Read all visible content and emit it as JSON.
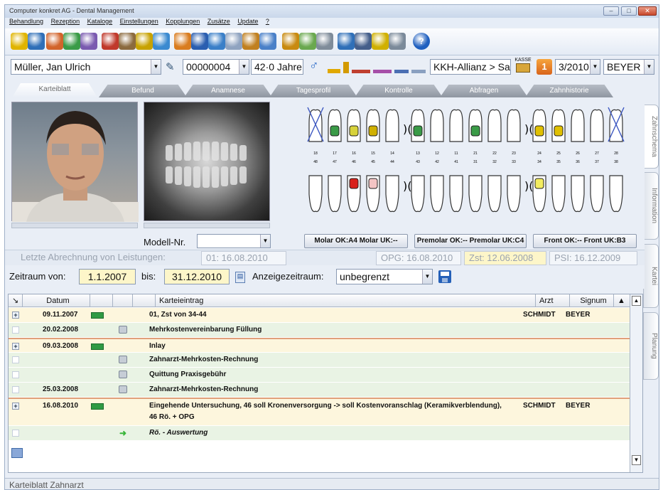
{
  "window": {
    "title": "Computer konkret AG - Dental Management"
  },
  "menu": [
    "Behandlung",
    "Rezeption",
    "Kataloge",
    "Einstellungen",
    "Kopplungen",
    "Zusätze",
    "Update",
    "?"
  ],
  "toolbar": {
    "icons": [
      "pointer-icon",
      "recliner-icon",
      "document-icon",
      "cross-icon",
      "chart-icon",
      "search-icon",
      "chair-icon",
      "key-icon",
      "bottle-icon",
      "pill-icon",
      "box-icon",
      "calendar-icon",
      "cloud-icon",
      "tooth-icon",
      "book-icon",
      "graduate-icon",
      "puzzle-icon",
      "printer-icon",
      "form-icon",
      "monitor-icon",
      "radiation-icon",
      "camera-icon",
      "help-icon"
    ]
  },
  "patient": {
    "name": "Müller, Jan Ulrich",
    "number": "00000004",
    "age": "42·0 Jahre",
    "insurance": "KKH-Allianz > Sa",
    "kasse_label": "KASSE",
    "quarter_badge": "1",
    "quarter": "3/2010",
    "doctor": "BEYER"
  },
  "tabs": [
    "Karteiblatt",
    "Befund",
    "Anamnese",
    "Tagesprofil",
    "Kontrolle",
    "Abfragen",
    "Zahnhistorie"
  ],
  "side_tabs": [
    "Zahnschema",
    "Information",
    "Kartei",
    "Planung"
  ],
  "model": {
    "label": "Modell-Nr.",
    "value": ""
  },
  "teeth_upper_numbers": [
    "18",
    "17",
    "16",
    "15",
    "14",
    "13",
    "12",
    "11",
    "21",
    "22",
    "23",
    "24",
    "25",
    "26",
    "27",
    "28"
  ],
  "teeth_lower_numbers": [
    "48",
    "47",
    "46",
    "45",
    "44",
    "43",
    "42",
    "41",
    "31",
    "32",
    "33",
    "34",
    "35",
    "36",
    "37",
    "38"
  ],
  "teeth_buttons": {
    "molar": "Molar OK:A4 Molar UK:--",
    "premolar": "Premolar OK:-- Premolar UK:C4",
    "front": "Front OK:-- Front UK:B3"
  },
  "billing": {
    "label": "Letzte Abrechnung von Leistungen:",
    "date": "01: 16.08.2010",
    "opg": "OPG: 16.08.2010",
    "zst": "Zst: 12.06.2008",
    "psi": "PSI: 16.12.2009"
  },
  "period": {
    "from_label": "Zeitraum von:",
    "from": "1.1.2007",
    "to_label": "bis:",
    "to": "31.12.2010",
    "display_label": "Anzeigezeitraum:",
    "display_value": "unbegrenzt"
  },
  "grid": {
    "columns": [
      "Datum",
      "Karteieintrag",
      "Arzt",
      "Signum"
    ],
    "rows": [
      {
        "type": "y",
        "expand": true,
        "date": "09.11.2007",
        "tag": true,
        "icon": "",
        "entry": "01, Zst von 34-44",
        "arzt": "SCHMIDT",
        "signum": "BEYER",
        "italic": false
      },
      {
        "type": "g",
        "expand": false,
        "date": "20.02.2008",
        "tag": false,
        "icon": "printer",
        "entry": "Mehrkostenvereinbarung Füllung",
        "arzt": "",
        "signum": "",
        "italic": false
      },
      {
        "type": "y",
        "expand": true,
        "date": "09.03.2008",
        "tag": true,
        "icon": "",
        "entry": "Inlay",
        "arzt": "",
        "signum": "",
        "italic": false
      },
      {
        "type": "g",
        "expand": false,
        "date": "",
        "tag": false,
        "icon": "printer",
        "entry": "Zahnarzt-Mehrkosten-Rechnung",
        "arzt": "",
        "signum": "",
        "italic": false
      },
      {
        "type": "g",
        "expand": false,
        "date": "",
        "tag": false,
        "icon": "printer",
        "entry": "Quittung Praxisgebühr",
        "arzt": "",
        "signum": "",
        "italic": false
      },
      {
        "type": "g",
        "expand": false,
        "date": "25.03.2008",
        "tag": false,
        "icon": "printer",
        "entry": "Zahnarzt-Mehrkosten-Rechnung",
        "arzt": "",
        "signum": "",
        "italic": false
      },
      {
        "type": "y",
        "expand": true,
        "date": "16.08.2010",
        "tag": true,
        "icon": "",
        "entry": "Eingehende Untersuchung, 46 soll Kronenversorgung -> soll Kostenvoranschlag (Keramikverblendung),",
        "entry2": "46 Rö. + OPG",
        "arzt": "SCHMIDT",
        "signum": "BEYER",
        "italic": false
      },
      {
        "type": "g",
        "expand": false,
        "date": "",
        "tag": false,
        "icon": "arrow",
        "entry": "Rö. - Auswertung",
        "arzt": "",
        "signum": "",
        "italic": true
      }
    ]
  },
  "status": "Karteiblatt Zahnarzt",
  "colors": {
    "accent_yellow": "#fdf6c9",
    "row_green": "#e9f3e4",
    "row_yellow": "#fdf6dd",
    "tag_green": "#2f9a44"
  }
}
